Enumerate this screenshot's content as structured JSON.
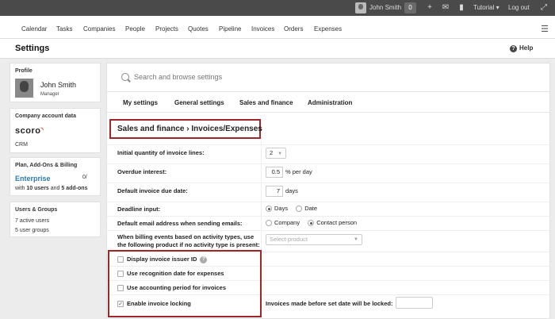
{
  "topbar": {
    "user_name": "John Smith",
    "badge_count": "0",
    "tutorial": "Tutorial",
    "logout": "Log out"
  },
  "nav": {
    "items": [
      "Calendar",
      "Tasks",
      "Companies",
      "People",
      "Projects",
      "Quotes",
      "Pipeline",
      "Invoices",
      "Orders",
      "Expenses"
    ]
  },
  "header": {
    "title": "Settings",
    "help": "Help"
  },
  "profile": {
    "title": "Profile",
    "name": "John Smith",
    "role": "Manager"
  },
  "company": {
    "title": "Company account data",
    "logo": "scoro",
    "type": "CRM"
  },
  "plan": {
    "title": "Plan, Add-Ons & Billing",
    "name": "Enterprise",
    "count": "0/",
    "desc_prefix": "with ",
    "users": "10 users",
    "desc_mid": " and ",
    "addons": "5 add-ons"
  },
  "users_groups": {
    "title": "Users & Groups",
    "active": "7 active users",
    "groups": "5 user groups"
  },
  "search": {
    "placeholder": "Search and browse settings"
  },
  "tabs": [
    "My settings",
    "General settings",
    "Sales and finance",
    "Administration"
  ],
  "section_title": "Sales and finance › Invoices/Expenses",
  "fields": {
    "invoice_lines_label": "Initial quantity of invoice lines:",
    "invoice_lines_value": "2",
    "overdue_label": "Overdue interest:",
    "overdue_value": "0.5",
    "overdue_unit": "% per day",
    "due_label": "Default invoice due date:",
    "due_value": "7",
    "due_unit": "days",
    "deadline_label": "Deadline input:",
    "deadline_opt1": "Days",
    "deadline_opt2": "Date",
    "email_label": "Default email address when sending emails:",
    "email_opt1": "Company",
    "email_opt2": "Contact person",
    "billing_label_line1": "When billing events based on activity types, use",
    "billing_label_line2": "the following product if no activity type is present:",
    "billing_placeholder": "Select product"
  },
  "checkboxes": [
    {
      "label": "Display invoice issuer ID",
      "checked": false
    },
    {
      "label": "Use recognition date for expenses",
      "checked": false
    },
    {
      "label": "Use accounting period for invoices",
      "checked": false
    },
    {
      "label": "Enable invoice locking",
      "checked": true
    }
  ],
  "lock_label": "Invoices made before set date will be locked:"
}
